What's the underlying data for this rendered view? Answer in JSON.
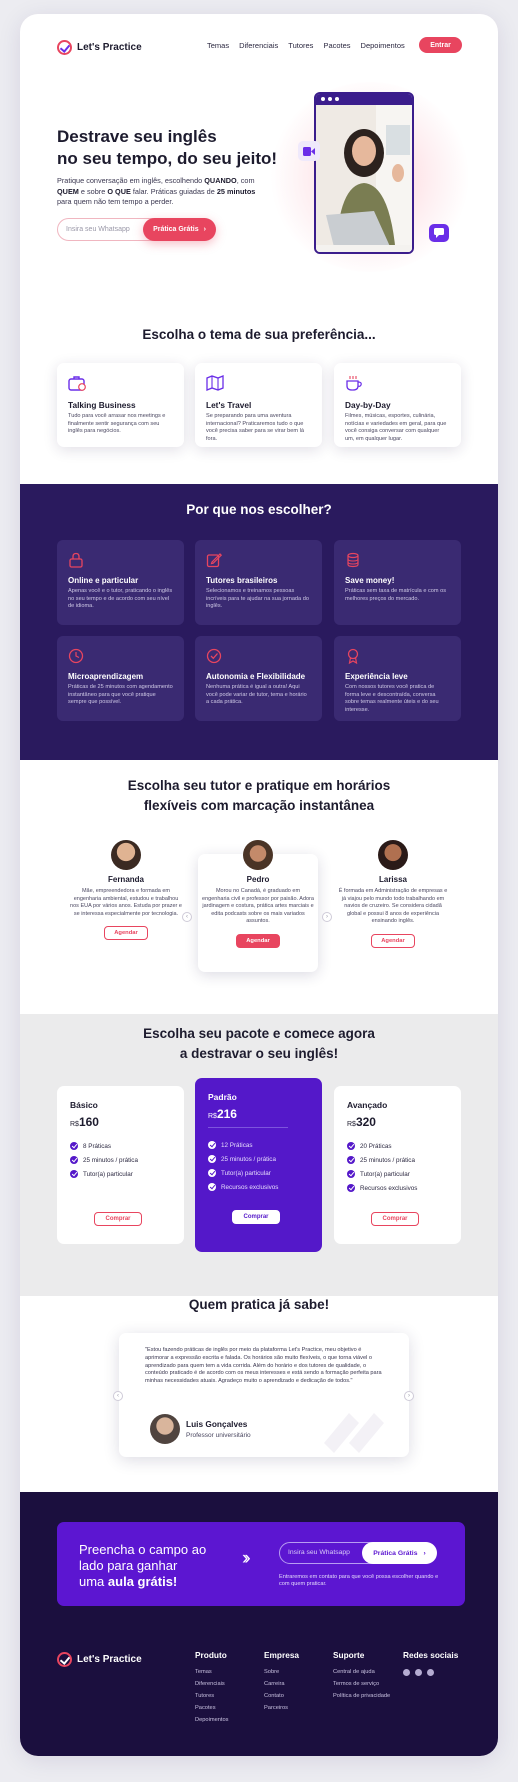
{
  "nav": {
    "brand": "Let's Practice",
    "links": [
      "Temas",
      "Diferenciais",
      "Tutores",
      "Pacotes",
      "Depoimentos"
    ],
    "login": "Entrar"
  },
  "hero": {
    "title_line1": "Destrave seu inglês",
    "title_line2": "no seu tempo, do seu jeito!",
    "text": {
      "t1": "Pratique conversação em inglês, escolhendo ",
      "b1": "QUANDO",
      "t2": ", com ",
      "b2": "QUEM",
      "t3": " e sobre ",
      "b3": "O QUE",
      "t4": "  falar. Práticas guiadas de ",
      "b4": "25 minutos",
      "t5": " para quem não tem tempo a perder."
    },
    "input_placeholder": "Insira seu Whatsapp",
    "button": "Prática Grátis"
  },
  "themes": {
    "title": "Escolha o tema de sua preferência...",
    "items": [
      {
        "title": "Talking Business",
        "desc": "Tudo para você arrasar nos meetings e finalmente sentir segurança com seu inglês para negócios.",
        "icon": "briefcase-icon"
      },
      {
        "title": "Let's Travel",
        "desc": "Se preparando para uma aventura internacional? Praticaremos tudo o que você precisa saber para se virar bem lá fora.",
        "icon": "map-icon"
      },
      {
        "title": "Day-by-Day",
        "desc": "Filmes, músicas, esportes, culinária, notícias e variedades em geral, para que você consiga conversar com qualquer um, em qualquer lugar.",
        "icon": "coffee-icon"
      }
    ]
  },
  "why": {
    "title": "Por que nos escolher?",
    "items": [
      {
        "title": "Online e particular",
        "desc": "Apenas você e o tutor, praticando o inglês no seu tempo e de acordo com seu nível de idioma.",
        "icon": "lock-icon"
      },
      {
        "title": "Tutores brasileiros",
        "desc": "Selecionamos e treinamos pessoas incríveis para te ajudar na sua jornada do inglês.",
        "icon": "edit-icon"
      },
      {
        "title": "Save money!",
        "desc": "Práticas sem taxa de matrícula e com os melhores preços do mercado.",
        "icon": "coins-icon"
      },
      {
        "title": "Microaprendizagem",
        "desc": "Práticas de 25 minutos com agendamento instantâneo para que você pratique sempre que possível.",
        "icon": "clock-icon"
      },
      {
        "title": "Autonomia e Flexibilidade",
        "desc": "Nenhuma prática é igual a outra! Aqui você pode variar de tutor, tema e horário a cada prática.",
        "icon": "check-circle-icon"
      },
      {
        "title": "Experiência leve",
        "desc": "Com nossos tutores você pratica de forma leve e descontraída, conversa sobre temas realmente úteis e do seu interesse.",
        "icon": "medal-icon"
      }
    ]
  },
  "tutors": {
    "title_line1": "Escolha seu tutor e pratique em horários",
    "title_line2": "flexíveis com marcação instantânea",
    "items": [
      {
        "name": "Fernanda",
        "desc": "Mãe, empreendedora e formada em engenharia ambiental, estudou e trabalhou nos EUA por vários anos. Estuda por prazer e se interessa especialmente por tecnologia.",
        "button": "Agendar"
      },
      {
        "name": "Pedro",
        "desc": "Morou no Canadá, é graduado em engenharia civil e professor por paixão. Adora jardinagem e costura, prática artes marciais e edita podcasts sobre os mais variados assuntos.",
        "button": "Agendar"
      },
      {
        "name": "Larissa",
        "desc": "É formada em Administração de empresas e já viajou pelo mundo todo trabalhando em navios de cruzeiro. Se considera cidadã global e possui 8 anos de experiência ensinando inglês.",
        "button": "Agendar"
      }
    ],
    "prev": "‹",
    "next": "›"
  },
  "packages": {
    "title_line1": "Escolha seu pacote e comece agora",
    "title_line2": "a destravar o seu inglês!",
    "currency": "R$",
    "items": [
      {
        "name": "Básico",
        "price": "160",
        "features": [
          "8 Práticas",
          "25 minutos / prática",
          "Tutor(a) particular"
        ],
        "button": "Comprar"
      },
      {
        "name": "Padrão",
        "price": "216",
        "features": [
          "12 Práticas",
          "25 minutos / prática",
          "Tutor(a) particular",
          "Recursos exclusivos"
        ],
        "button": "Comprar"
      },
      {
        "name": "Avançado",
        "price": "320",
        "features": [
          "20 Práticas",
          "25 minutos / prática",
          "Tutor(a) particular",
          "Recursos exclusivos"
        ],
        "button": "Comprar"
      }
    ]
  },
  "testimonials": {
    "title": "Quem pratica já sabe!",
    "quote": "\"Estou fazendo práticas de inglês por meio da plataforma Let's Practice, meu objetivo é aprimorar a expressão escrita e falada. Os horários são muito flexíveis, o que torna viável o aprendizado para quem tem a vida corrida.  Além do horário e dos tutores de qualidade, o conteúdo praticado é de acordo com os meus interesses e está sendo a formação perfeita para minhas necessidades atuais. Agradeço muito o aprendizado e dedicação de todos.\"",
    "name": "Luis Gonçalves",
    "role": "Professor universitário",
    "prev": "‹",
    "next": "›"
  },
  "cta": {
    "line1": "Preencha o campo ao",
    "line2": "lado para ganhar",
    "line3_pre": "uma ",
    "line3_bold": "aula grátis!",
    "input_placeholder": "Insira seu Whatsapp",
    "button": "Prática Grátis",
    "note": "Entraremos em contato para que você possa escolher quando e com quem praticar."
  },
  "footer": {
    "brand": "Let's Practice",
    "columns": [
      {
        "title": "Produto",
        "links": [
          "Temas",
          "Diferenciais",
          "Tutores",
          "Pacotes",
          "Depoimentos"
        ]
      },
      {
        "title": "Empresa",
        "links": [
          "Sobre",
          "Carreira",
          "Contato",
          "Parceiros"
        ]
      },
      {
        "title": "Suporte",
        "links": [
          "Central de ajuda",
          "Termos de serviço",
          "Política de privacidade"
        ]
      }
    ],
    "social_title": "Redes sociais",
    "socials": [
      "instagram-icon",
      "twitter-icon",
      "youtube-icon"
    ]
  },
  "colors": {
    "accent": "#e8455f",
    "purple": "#5418c9",
    "dark": "#2a1a5e",
    "footer": "#1b0f3e"
  }
}
